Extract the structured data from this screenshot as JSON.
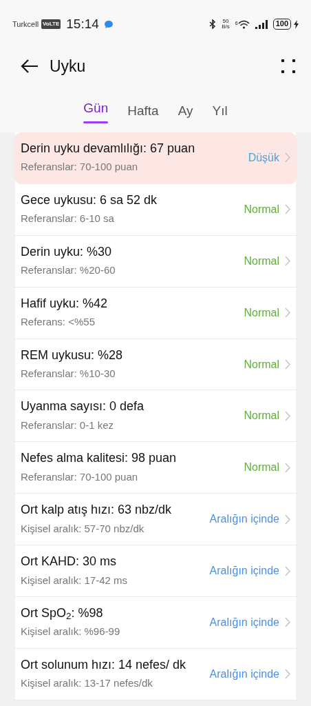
{
  "status_bar": {
    "carrier": "Turkcell",
    "volte": "VoLTE",
    "time": "15:14",
    "speed_value": "50",
    "speed_unit": "B/s",
    "wifi_gen": "6",
    "battery": "100"
  },
  "header": {
    "title": "Uyku"
  },
  "tabs": [
    {
      "label": "Gün",
      "selected": true
    },
    {
      "label": "Hafta",
      "selected": false
    },
    {
      "label": "Ay",
      "selected": false
    },
    {
      "label": "Yıl",
      "selected": false
    }
  ],
  "rows": [
    {
      "title": "Derin uyku devamlılığı: 67 puan",
      "reference": "Referanslar: 70-100 puan",
      "status": "Düşük",
      "kind": "low",
      "highlighted": true
    },
    {
      "title": "Gece uykusu: 6 sa 52 dk",
      "reference": "Referanslar: 6-10 sa",
      "status": "Normal",
      "kind": "normal",
      "highlighted": false
    },
    {
      "title": "Derin uyku: %30",
      "reference": "Referanslar: %20-60",
      "status": "Normal",
      "kind": "normal",
      "highlighted": false
    },
    {
      "title": "Hafif uyku: %42",
      "reference": "Referans: <%55",
      "status": "Normal",
      "kind": "normal",
      "highlighted": false
    },
    {
      "title": "REM uykusu: %28",
      "reference": "Referanslar: %10-30",
      "status": "Normal",
      "kind": "normal",
      "highlighted": false
    },
    {
      "title": "Uyanma sayısı: 0 defa",
      "reference": "Referanslar: 0-1 kez",
      "status": "Normal",
      "kind": "normal",
      "highlighted": false
    },
    {
      "title": "Nefes alma kalitesi: 98 puan",
      "reference": "Referanslar: 70-100 puan",
      "status": "Normal",
      "kind": "normal",
      "highlighted": false
    },
    {
      "title": "Ort kalp atış hızı: 63 nbz/dk",
      "reference": "Kişisel aralık: 57-70 nbz/dk",
      "status": "Aralığın içinde",
      "kind": "in_range",
      "highlighted": false
    },
    {
      "title": "Ort KAHD: 30 ms",
      "reference": "Kişisel aralık: 17-42 ms",
      "status": "Aralığın içinde",
      "kind": "in_range",
      "highlighted": false
    },
    {
      "title": "Ort SpO$_{2}$: %98",
      "reference": "Kişisel aralık: %96-99",
      "status": "Aralığın içinde",
      "kind": "in_range",
      "highlighted": false
    },
    {
      "title": "Ort solunum hızı: 14 nefes/ dk",
      "reference": "Kişisel aralık: 13-17 nefes/dk",
      "status": "Aralığın içinde",
      "kind": "in_range",
      "highlighted": false
    }
  ]
}
